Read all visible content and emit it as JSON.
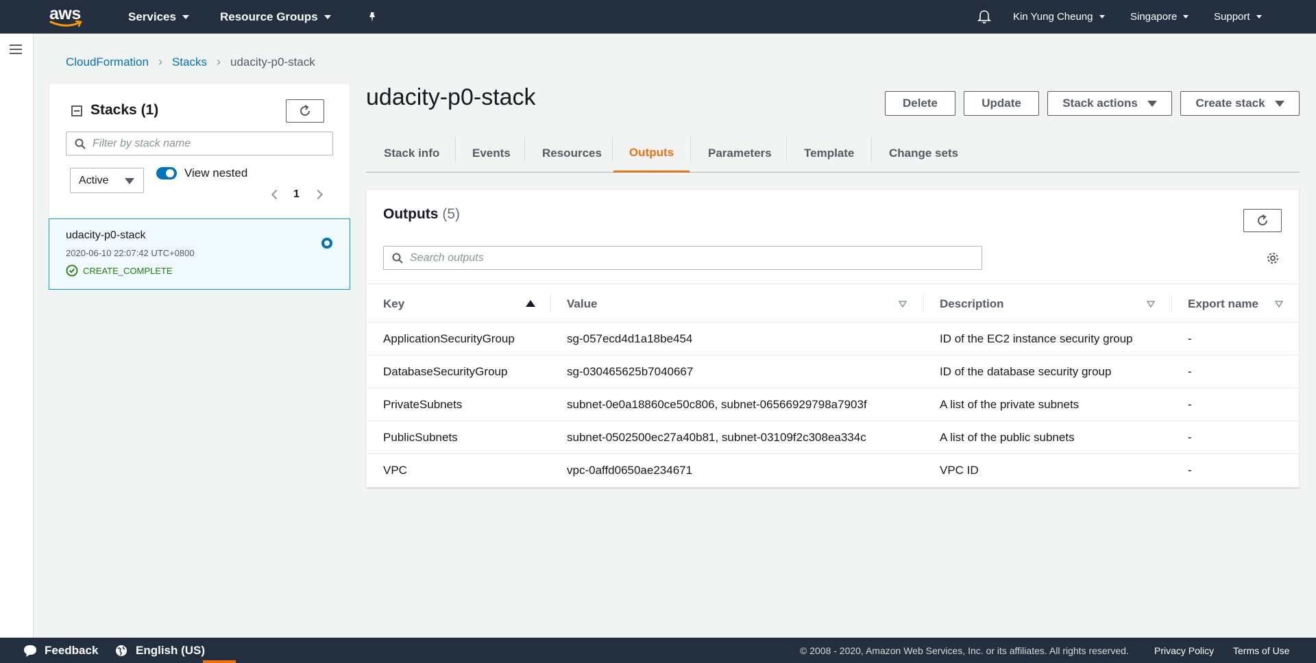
{
  "topnav": {
    "logo": "aws",
    "services": "Services",
    "resource_groups": "Resource Groups",
    "pin_icon": "pin-icon",
    "bell_icon": "bell-icon",
    "user": "Kin Yung Cheung",
    "region": "Singapore",
    "support": "Support"
  },
  "breadcrumb": {
    "items": [
      "CloudFormation",
      "Stacks"
    ],
    "current": "udacity-p0-stack"
  },
  "stacks_panel": {
    "title": "Stacks",
    "count": "(1)",
    "search_placeholder": "Filter by stack name",
    "filter_value": "Active",
    "view_nested_label": "View nested",
    "view_nested_on": true,
    "page": "1",
    "stacks": [
      {
        "name": "udacity-p0-stack",
        "created": "2020-06-10 22:07:42 UTC+0800",
        "status": "CREATE_COMPLETE"
      }
    ]
  },
  "main": {
    "title": "udacity-p0-stack",
    "actions": {
      "delete": "Delete",
      "update": "Update",
      "stack_actions": "Stack actions",
      "create_stack": "Create stack"
    },
    "tabs": [
      "Stack info",
      "Events",
      "Resources",
      "Outputs",
      "Parameters",
      "Template",
      "Change sets"
    ],
    "active_tab": "Outputs"
  },
  "outputs": {
    "title": "Outputs",
    "count": "(5)",
    "search_placeholder": "Search outputs",
    "columns": [
      "Key",
      "Value",
      "Description",
      "Export name"
    ],
    "rows": [
      [
        "ApplicationSecurityGroup",
        "sg-057ecd4d1a18be454",
        "ID of the EC2 instance security group",
        "-"
      ],
      [
        "DatabaseSecurityGroup",
        "sg-030465625b7040667",
        "ID of the database security group",
        "-"
      ],
      [
        "PrivateSubnets",
        "subnet-0e0a18860ce50c806, subnet-06566929798a7903f",
        "A list of the private subnets",
        "-"
      ],
      [
        "PublicSubnets",
        "subnet-0502500ec27a40b81, subnet-03109f2c308ea334c",
        "A list of the public subnets",
        "-"
      ],
      [
        "VPC",
        "vpc-0affd0650ae234671",
        "VPC ID",
        "-"
      ]
    ]
  },
  "footer": {
    "feedback": "Feedback",
    "language": "English (US)",
    "copyright": "© 2008 - 2020, Amazon Web Services, Inc. or its affiliates. All rights reserved.",
    "privacy": "Privacy Policy",
    "terms": "Terms of Use"
  },
  "colors": {
    "nav_bg": "#232f3e",
    "accent_orange": "#ec7211",
    "link_blue": "#0073bb",
    "success_green": "#1d8102",
    "selected_bg": "#f1faff"
  }
}
